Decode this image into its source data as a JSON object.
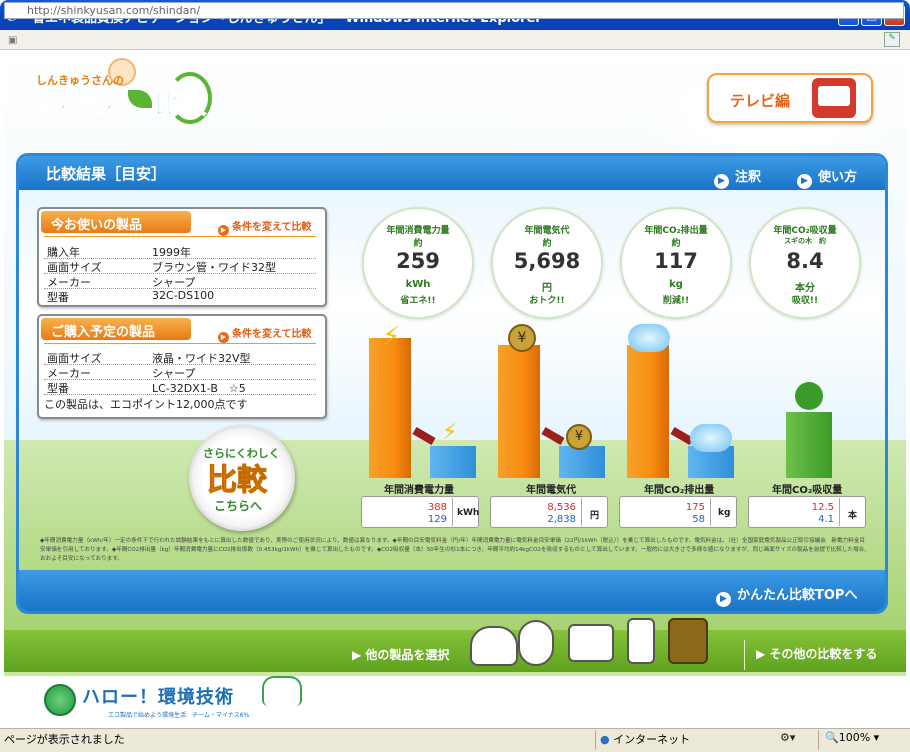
{
  "window": {
    "title": "省エネ製品買換ナビゲーション「しんきゅうさん」 - Windows Internet Explorer",
    "url": "http://shinkyusan.com/shindan/"
  },
  "header": {
    "logo_sub": "しんきゅうさんの",
    "logo_main": "かんたん",
    "logo_hikaku": "比較",
    "tv_label": "テレビ編"
  },
  "panel": {
    "title": "比較結果［目安］",
    "link_notes": "注釈",
    "link_howto": "使い方",
    "top_link": "かんたん比較TOPへ"
  },
  "current": {
    "heading": "今お使いの製品",
    "change": "条件を変えて比較",
    "rows": [
      {
        "k": "購入年",
        "v": "1999年"
      },
      {
        "k": "画面サイズ",
        "v": "ブラウン管・ワイド32型"
      },
      {
        "k": "メーカー",
        "v": "シャープ"
      },
      {
        "k": "型番",
        "v": "32C-DS100"
      }
    ]
  },
  "planned": {
    "heading": "ご購入予定の製品",
    "change": "条件を変えて比較",
    "rows": [
      {
        "k": "画面サイズ",
        "v": "液晶・ワイド32V型"
      },
      {
        "k": "メーカー",
        "v": "シャープ"
      },
      {
        "k": "型番",
        "v": "LC-32DX1-B　☆5"
      }
    ],
    "ecopoint": "この製品は、エコポイント12,000点です"
  },
  "detail": {
    "line1": "さらにくわしく",
    "line2": "比較",
    "line3": "こちらへ"
  },
  "stats": [
    {
      "title": "年間消費電力量",
      "approx": "約",
      "value": "259",
      "unit": "kWh",
      "note": "省エネ!!"
    },
    {
      "title": "年間電気代",
      "approx": "約",
      "value": "5,698",
      "unit": "円",
      "note": "おトク!!"
    },
    {
      "title": "年間CO₂排出量",
      "approx": "約",
      "value": "117",
      "unit": "kg",
      "note": "削減!!"
    },
    {
      "title": "年間CO₂吸収量",
      "approx": "スギの木　約",
      "value": "8.4",
      "unit": "本分",
      "note": "吸収!!"
    }
  ],
  "bars": [
    {
      "label": "年間消費電力量",
      "old": "388",
      "new": "129",
      "unit": "kWh"
    },
    {
      "label": "年間電気代",
      "old": "8,536",
      "new": "2,838",
      "unit": "円"
    },
    {
      "label": "年間CO₂排出量",
      "old": "175",
      "new": "58",
      "unit": "kg"
    },
    {
      "label": "年間CO₂吸収量",
      "old": "12.5",
      "new": "4.1",
      "unit": "本"
    }
  ],
  "notes": "◆年間消費電力量（kWh/年）一定の条件下で行われた試験結果をもとに算出した数値であり、実際のご使用状況により、数値は異なります。◆年間の目安電気料金（円/年）年間消費電力量に電気料金目安単価（22円/1kWh（税込））を乗じて算出したものです。電気料金は、（社）全国家庭電気製品公正取引協議会　新電力料金目安単価を引用しております。◆年間CO2排出量（kg）年間消費電力量にCO2排出係数（0.453kg/1kWh）を乗じて算出したものです。◆CO2吸収量（本）50年生の杉1本につき、年間平均約14kgCO2を吸収するものとして算出しています。一般的には大きさで多様な値になりますが、同じ画面サイズの製品を前提で比較した場合、おおよそ目安になっております。",
  "bottom": {
    "select_other": "他の製品を選択",
    "other_compare": "その他の比較をする"
  },
  "footer": {
    "hello": "ハロー！環境技術",
    "sub": "エコ製品で始めよう環境生活　チーム・マイナス6%"
  },
  "status": {
    "text": "ページが表示されました",
    "zone": "インターネット",
    "zoom": "100%"
  }
}
